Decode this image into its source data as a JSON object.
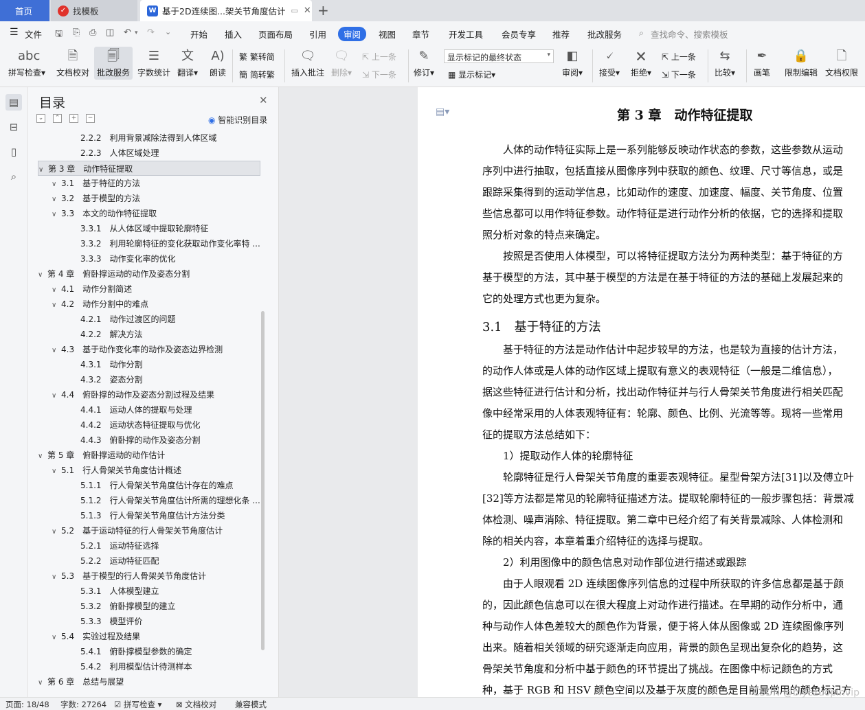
{
  "tabs": {
    "home": "首页",
    "zhaomoban": "找模板",
    "doc": "基于2D连续图...架关节角度估计",
    "new_tab": "+"
  },
  "menu": {
    "file": "文件",
    "items": [
      "开始",
      "插入",
      "页面布局",
      "引用",
      "审阅",
      "视图",
      "章节",
      "开发工具",
      "会员专享",
      "推荐",
      "批改服务"
    ],
    "active": "审阅",
    "search_placeholder": "查找命令、搜索模板"
  },
  "ribbon": {
    "spell_check": "拼写检查",
    "doc_proof": "文档校对",
    "grading_service": "批改服务",
    "word_count": "字数统计",
    "translate": "翻译",
    "read_aloud": "朗读",
    "trad_convert": "繁转简",
    "simp_convert": "简转繁",
    "insert_comment": "插入批注",
    "delete": "删除",
    "prev": "上一条",
    "next": "下一条",
    "track_changes": "修订",
    "markup_select": "显示标记的最终状态",
    "show_markup": "显示标记",
    "review": "审阅",
    "accept": "接受",
    "reject": "拒绝",
    "prev2": "上一条",
    "next2": "下一条",
    "compare": "比较",
    "pen": "画笔",
    "restrict_edit": "限制编辑",
    "doc_permission": "文档权限"
  },
  "toc": {
    "title": "目录",
    "smart": "智能识别目录",
    "items": [
      {
        "text": "2.2.2　利用背景减除法得到人体区域",
        "level": 3
      },
      {
        "text": "2.2.3　人体区域处理",
        "level": 3
      },
      {
        "text": "第 3 章　动作特征提取",
        "level": 1,
        "selected": true
      },
      {
        "text": "3.1　基于特征的方法",
        "level": 2
      },
      {
        "text": "3.2　基于模型的方法",
        "level": 2
      },
      {
        "text": "3.3　本文的动作特征提取",
        "level": 2,
        "expand": true
      },
      {
        "text": "3.3.1　从人体区域中提取轮廓特征",
        "level": 3
      },
      {
        "text": "3.3.2　利用轮廓特征的变化获取动作变化率特 ...",
        "level": 3
      },
      {
        "text": "3.3.3　动作变化率的优化",
        "level": 3
      },
      {
        "text": "第 4 章　俯卧撑运动的动作及姿态分割",
        "level": 1
      },
      {
        "text": "4.1　动作分割简述",
        "level": 2
      },
      {
        "text": "4.2　动作分割中的难点",
        "level": 2,
        "expand": true
      },
      {
        "text": "4.2.1　动作过渡区的问题",
        "level": 3
      },
      {
        "text": "4.2.2　解决方法",
        "level": 3
      },
      {
        "text": "4.3　基于动作变化率的动作及姿态边界检测",
        "level": 2,
        "expand": true
      },
      {
        "text": "4.3.1　动作分割",
        "level": 3
      },
      {
        "text": "4.3.2　姿态分割",
        "level": 3
      },
      {
        "text": "4.4　俯卧撑的动作及姿态分割过程及结果",
        "level": 2,
        "expand": true
      },
      {
        "text": "4.4.1　运动人体的提取与处理",
        "level": 3
      },
      {
        "text": "4.4.2　运动状态特征提取与优化",
        "level": 3
      },
      {
        "text": "4.4.3　俯卧撑的动作及姿态分割",
        "level": 3
      },
      {
        "text": "第 5 章　俯卧撑运动的动作估计",
        "level": 1
      },
      {
        "text": "5.1　行人骨架关节角度估计概述",
        "level": 2,
        "expand": true
      },
      {
        "text": "5.1.1　行人骨架关节角度估计存在的难点",
        "level": 3
      },
      {
        "text": "5.1.2　行人骨架关节角度估计所需的理想化条 ...",
        "level": 3
      },
      {
        "text": "5.1.3　行人骨架关节角度估计方法分类",
        "level": 3
      },
      {
        "text": "5.2　基于运动特征的行人骨架关节角度估计",
        "level": 2,
        "expand": true
      },
      {
        "text": "5.2.1　运动特征选择",
        "level": 3
      },
      {
        "text": "5.2.2　运动特征匹配",
        "level": 3
      },
      {
        "text": "5.3　基于模型的行人骨架关节角度估计",
        "level": 2,
        "expand": true
      },
      {
        "text": "5.3.1　人体模型建立",
        "level": 3
      },
      {
        "text": "5.3.2　俯卧撑模型的建立",
        "level": 3
      },
      {
        "text": "5.3.3　模型评价",
        "level": 3
      },
      {
        "text": "5.4　实验过程及结果",
        "level": 2,
        "expand": true
      },
      {
        "text": "5.4.1　俯卧撑模型参数的确定",
        "level": 3
      },
      {
        "text": "5.4.2　利用模型估计待测样本",
        "level": 3
      },
      {
        "text": "第 6 章　总结与展望",
        "level": 1
      }
    ]
  },
  "doc": {
    "heading": "第 3 章　动作特征提取",
    "section": "3.1　基于特征的方法",
    "lines_a": [
      "　　人体的动作特征实际上是一系列能够反映动作状态的参数，这些参数从运动",
      "序列中进行抽取，包括直接从图像序列中获取的颜色、纹理、尺寸等信息，或是",
      "跟踪采集得到的运动学信息，比如动作的速度、加速度、幅度、关节角度、位置",
      "些信息都可以用作特征参数。动作特征是进行动作分析的依据，它的选择和提取",
      "照分析对象的特点来确定。",
      "　　按照是否使用人体模型，可以将特征提取方法分为两种类型：基于特征的方",
      "基于模型的方法，其中基于模型的方法是在基于特征的方法的基础上发展起来的",
      "它的处理方式也更为复杂。"
    ],
    "lines_b": [
      "　　基于特征的方法是动作估计中起步较早的方法，也是较为直接的估计方法，",
      "的动作人体或是人体的动作区域上提取有意义的表观特征（一般是二维信息），",
      "据这些特征进行估计和分析，找出动作特征并与行人骨架关节角度进行相关匹配",
      "像中经常采用的人体表观特征有：轮廓、颜色、比例、光流等等。现将一些常用",
      "征的提取方法总结如下：",
      "　　1）提取动作人体的轮廓特征",
      "　　轮廓特征是行人骨架关节角度的重要表观特征。星型骨架方法[31]以及傅立叶",
      "[32]等方法都是常见的轮廓特征描述方法。提取轮廓特征的一般步骤包括：背景减",
      "体检测、噪声消除、特征提取。第二章中已经介绍了有关背景减除、人体检测和",
      "除的相关内容，本章着重介绍特征的选择与提取。",
      "　　2）利用图像中的颜色信息对动作部位进行描述或跟踪",
      "　　由于人眼观看 2D 连续图像序列信息的过程中所获取的许多信息都是基于颜",
      "的，因此颜色信息可以在很大程度上对动作进行描述。在早期的动作分析中，通",
      "种与动作人体色差较大的颜色作为背景，便于将人体从图像或 2D 连续图像序列",
      "出来。随着相关领域的研究逐渐走向应用，背景的颜色呈现出复杂化的趋势，这",
      "骨架关节角度和分析中基于颜色的环节提出了挑战。在图像中标记颜色的方式",
      "种，基于 RGB 和 HSV 颜色空间以及基于灰度的颜色是目前最常用的颜色标记方"
    ]
  },
  "status": {
    "page": "页面: 18/48",
    "words": "字数: 27264",
    "spell": "拼写检查",
    "proof": "文档校对",
    "compat": "兼容模式"
  },
  "watermark": "CSDN @biyezuopinvip"
}
